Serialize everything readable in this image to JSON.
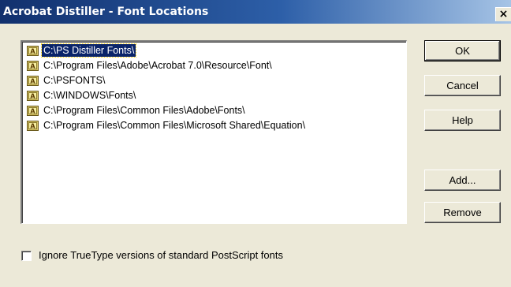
{
  "window": {
    "title": "Acrobat Distiller - Font Locations",
    "close_label": "×"
  },
  "font_list": {
    "items": [
      {
        "path": "C:\\PS Distiller Fonts\\",
        "selected": true
      },
      {
        "path": "C:\\Program Files\\Adobe\\Acrobat 7.0\\Resource\\Font\\",
        "selected": false
      },
      {
        "path": "C:\\PSFONTS\\",
        "selected": false
      },
      {
        "path": "C:\\WINDOWS\\Fonts\\",
        "selected": false
      },
      {
        "path": "C:\\Program Files\\Common Files\\Adobe\\Fonts\\",
        "selected": false
      },
      {
        "path": "C:\\Program Files\\Common Files\\Microsoft Shared\\Equation\\",
        "selected": false
      }
    ],
    "icon": "font-folder-icon"
  },
  "buttons": {
    "ok": "OK",
    "cancel": "Cancel",
    "help": "Help",
    "add": "Add...",
    "remove": "Remove"
  },
  "options": {
    "ignore_truetype_label": "Ignore TrueType versions of standard PostScript fonts",
    "ignore_truetype_checked": false
  }
}
